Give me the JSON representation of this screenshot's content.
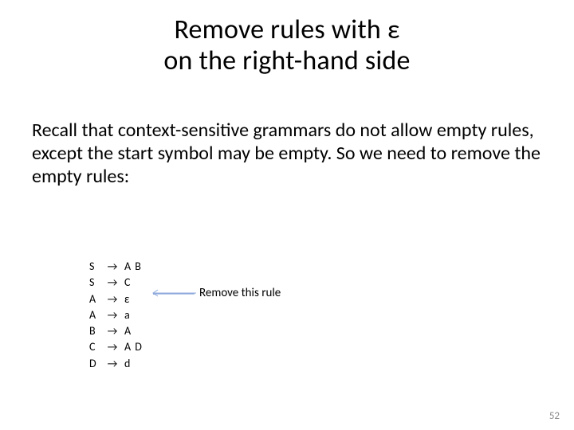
{
  "title_line1": "Remove rules with ε",
  "title_line2": "on the right-hand side",
  "body_text": "Recall that context-sensitive grammars do not allow empty rules, except the start symbol may be empty. So we need to remove the empty rules:",
  "arrow_glyph": "→",
  "grammar": {
    "rules": [
      {
        "lhs": "S",
        "rhs": "A B"
      },
      {
        "lhs": "S",
        "rhs": "C"
      },
      {
        "lhs": "A",
        "rhs": "ε"
      },
      {
        "lhs": "A",
        "rhs": "a"
      },
      {
        "lhs": "B",
        "rhs": "A"
      },
      {
        "lhs": "C",
        "rhs": "A D"
      },
      {
        "lhs": "D",
        "rhs": "d"
      }
    ]
  },
  "callout": "Remove this rule",
  "page_number": "52",
  "colors": {
    "callout_arrow": "#8faadc"
  }
}
